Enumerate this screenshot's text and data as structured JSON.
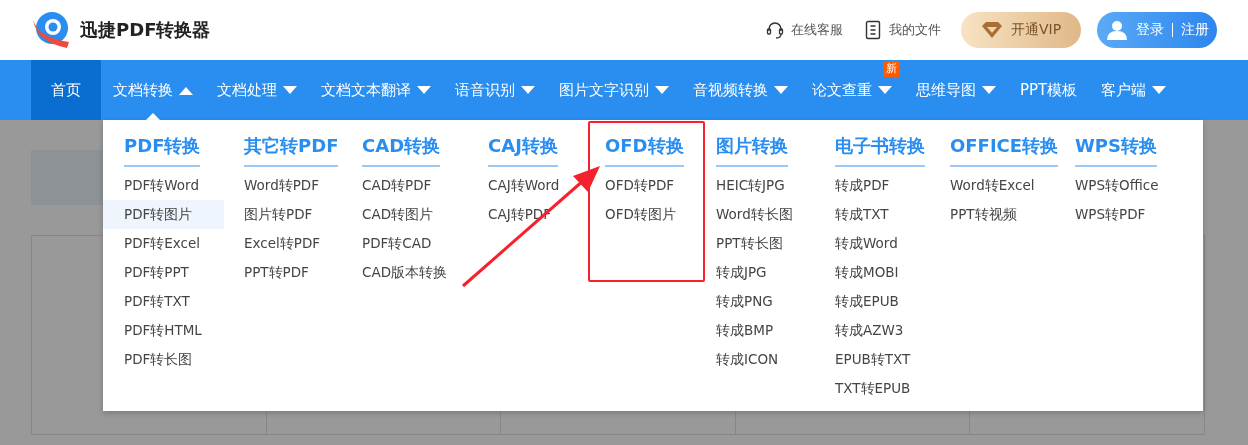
{
  "header": {
    "title": "迅捷PDF转换器",
    "links": [
      {
        "kind": "service",
        "label": "在线客服"
      },
      {
        "kind": "files",
        "label": "我的文件"
      }
    ],
    "vip_button": "开通VIP",
    "login": {
      "login": "登录",
      "register": "注册"
    }
  },
  "nav": [
    {
      "label": "首页",
      "selected": true,
      "kind": "link"
    },
    {
      "label": "文档转换",
      "selected": false,
      "kind": "dropdown",
      "expanded": true
    },
    {
      "label": "文档处理",
      "selected": false,
      "kind": "dropdown",
      "expanded": false
    },
    {
      "label": "文档文本翻译",
      "selected": false,
      "kind": "dropdown",
      "expanded": false
    },
    {
      "label": "语音识别",
      "selected": false,
      "kind": "dropdown",
      "expanded": false
    },
    {
      "label": "图片文字识别",
      "selected": false,
      "kind": "dropdown",
      "expanded": false
    },
    {
      "label": "音视频转换",
      "selected": false,
      "kind": "dropdown",
      "expanded": false
    },
    {
      "label": "论文查重",
      "selected": false,
      "kind": "dropdown",
      "expanded": false,
      "badge": "新"
    },
    {
      "label": "思维导图",
      "selected": false,
      "kind": "dropdown",
      "expanded": false
    },
    {
      "label": "PPT模板",
      "selected": false,
      "kind": "link"
    },
    {
      "label": "客户端",
      "selected": false,
      "kind": "dropdown",
      "expanded": false
    }
  ],
  "dropdown": {
    "columns": [
      {
        "title": "PDF转换",
        "highlighted": false,
        "items": [
          {
            "label": "PDF转Word",
            "selected": false
          },
          {
            "label": "PDF转图片",
            "selected": true
          },
          {
            "label": "PDF转Excel",
            "selected": false
          },
          {
            "label": "PDF转PPT",
            "selected": false
          },
          {
            "label": "PDF转TXT",
            "selected": false
          },
          {
            "label": "PDF转HTML",
            "selected": false
          },
          {
            "label": "PDF转长图",
            "selected": false
          }
        ]
      },
      {
        "title": "其它转PDF",
        "highlighted": false,
        "items": [
          {
            "label": "Word转PDF",
            "selected": false
          },
          {
            "label": "图片转PDF",
            "selected": false
          },
          {
            "label": "Excel转PDF",
            "selected": false
          },
          {
            "label": "PPT转PDF",
            "selected": false
          }
        ]
      },
      {
        "title": "CAD转换",
        "highlighted": false,
        "items": [
          {
            "label": "CAD转PDF",
            "selected": false
          },
          {
            "label": "CAD转图片",
            "selected": false
          },
          {
            "label": "PDF转CAD",
            "selected": false
          },
          {
            "label": "CAD版本转换",
            "selected": false
          }
        ]
      },
      {
        "title": "CAJ转换",
        "highlighted": false,
        "items": [
          {
            "label": "CAJ转Word",
            "selected": false
          },
          {
            "label": "CAJ转PDF",
            "selected": false
          }
        ]
      },
      {
        "title": "OFD转换",
        "highlighted": true,
        "items": [
          {
            "label": "OFD转PDF",
            "selected": false
          },
          {
            "label": "OFD转图片",
            "selected": false
          }
        ]
      },
      {
        "title": "图片转换",
        "highlighted": false,
        "items": [
          {
            "label": "HEIC转JPG",
            "selected": false
          },
          {
            "label": "Word转长图",
            "selected": false
          },
          {
            "label": "PPT转长图",
            "selected": false
          },
          {
            "label": "转成JPG",
            "selected": false
          },
          {
            "label": "转成PNG",
            "selected": false
          },
          {
            "label": "转成BMP",
            "selected": false
          },
          {
            "label": "转成ICON",
            "selected": false
          }
        ]
      },
      {
        "title": "电子书转换",
        "highlighted": false,
        "items": [
          {
            "label": "转成PDF",
            "selected": false
          },
          {
            "label": "转成TXT",
            "selected": false
          },
          {
            "label": "转成Word",
            "selected": false
          },
          {
            "label": "转成MOBI",
            "selected": false
          },
          {
            "label": "转成EPUB",
            "selected": false
          },
          {
            "label": "转成AZW3",
            "selected": false
          },
          {
            "label": "EPUB转TXT",
            "selected": false
          },
          {
            "label": "TXT转EPUB",
            "selected": false
          }
        ]
      },
      {
        "title": "OFFICE转换",
        "highlighted": false,
        "items": [
          {
            "label": "Word转Excel",
            "selected": false
          },
          {
            "label": "PPT转视频",
            "selected": false
          }
        ]
      },
      {
        "title": "WPS转换",
        "highlighted": false,
        "items": [
          {
            "label": "WPS转Office",
            "selected": false
          },
          {
            "label": "WPS转PDF",
            "selected": false
          }
        ]
      }
    ]
  }
}
